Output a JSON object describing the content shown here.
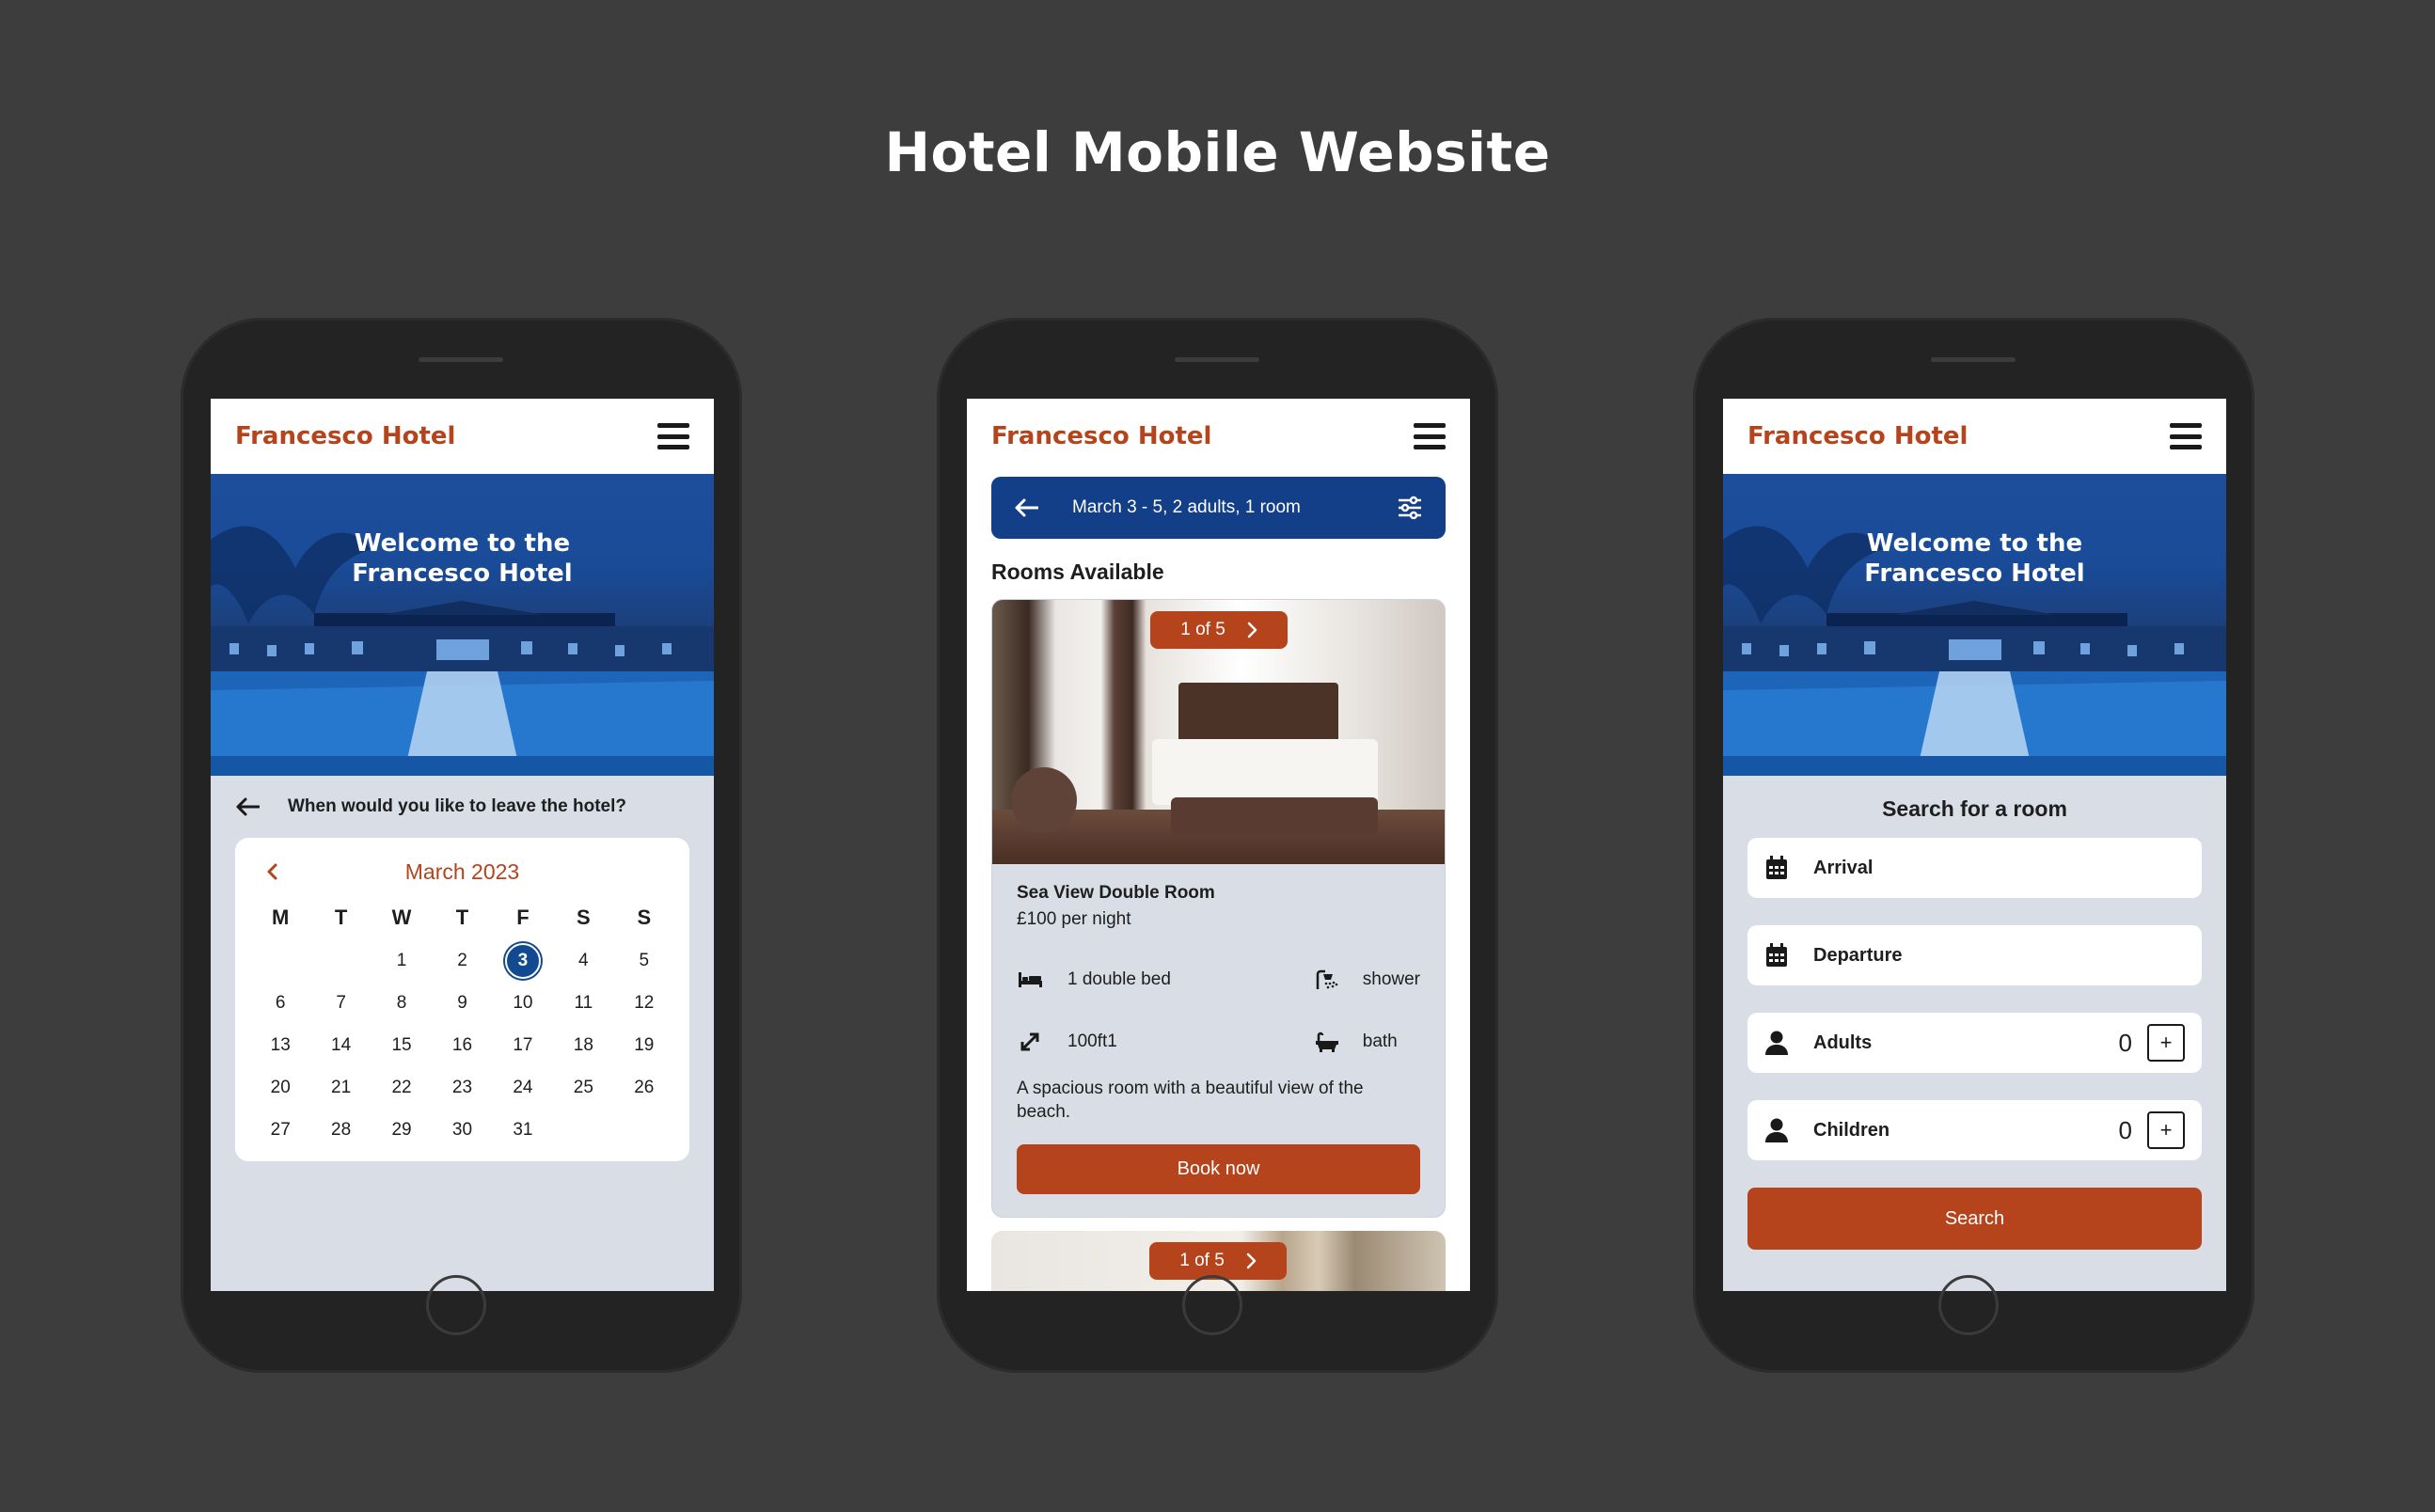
{
  "page": {
    "title": "Hotel Mobile Website"
  },
  "brand": "Francesco Hotel",
  "hero": {
    "line1": "Welcome to the",
    "line2": "Francesco Hotel"
  },
  "screen1": {
    "question": "When would you like to leave the hotel?",
    "calendar": {
      "month": "March 2023",
      "weekdays": [
        "M",
        "T",
        "W",
        "T",
        "F",
        "S",
        "S"
      ],
      "leading_blanks": 2,
      "days": [
        "1",
        "2",
        "3",
        "4",
        "5",
        "6",
        "7",
        "8",
        "9",
        "10",
        "11",
        "12",
        "13",
        "14",
        "15",
        "16",
        "17",
        "18",
        "19",
        "20",
        "21",
        "22",
        "23",
        "24",
        "25",
        "26",
        "27",
        "28",
        "29",
        "30",
        "31"
      ],
      "selected": "3"
    }
  },
  "screen2": {
    "filter_text": "March 3 - 5, 2 adults, 1 room",
    "rooms_heading": "Rooms Available",
    "room": {
      "pager": "1 of 5",
      "name": "Sea View Double Room",
      "price": "£100 per night",
      "amenities": [
        {
          "icon": "bed-icon",
          "label": "1 double bed"
        },
        {
          "icon": "shower-icon",
          "label": "shower"
        },
        {
          "icon": "expand-icon",
          "label": "100ft1"
        },
        {
          "icon": "bath-icon",
          "label": "bath"
        }
      ],
      "description": "A spacious room with a beautiful view of the beach.",
      "book_label": "Book now"
    },
    "room2": {
      "pager": "1 of 5"
    }
  },
  "screen3": {
    "title": "Search for a room",
    "arrival_label": "Arrival",
    "departure_label": "Departure",
    "adults_label": "Adults",
    "adults_count": "0",
    "children_label": "Children",
    "children_count": "0",
    "plus_label": "+",
    "search_label": "Search"
  },
  "colors": {
    "accent": "#b5431c",
    "primary_blue": "#123f88",
    "screen_bg": "#d8dde6",
    "canvas_bg": "#3d3d3d"
  }
}
